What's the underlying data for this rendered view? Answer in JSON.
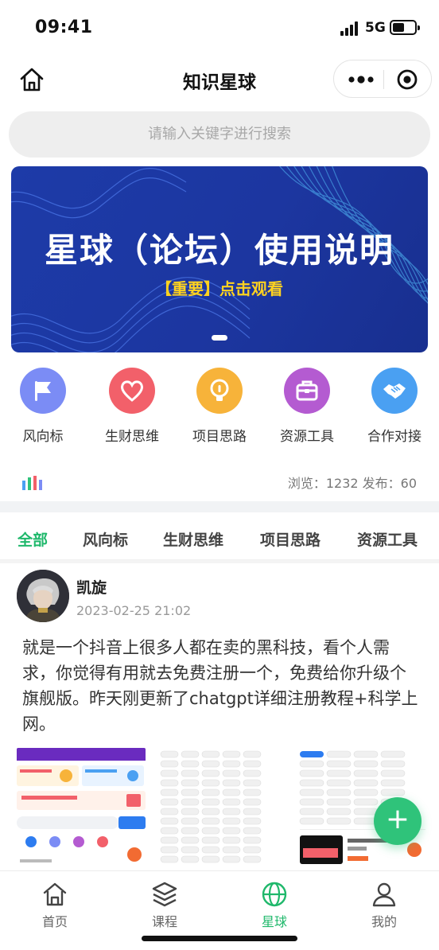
{
  "status_bar": {
    "time": "09:41",
    "network": "5G"
  },
  "nav": {
    "title": "知识星球"
  },
  "search": {
    "placeholder": "请输入关键字进行搜索"
  },
  "banner": {
    "title": "星球（论坛）使用说明",
    "subtitle": "【重要】点击观看"
  },
  "categories": [
    {
      "label": "风向标",
      "icon": "flag-icon",
      "color": "#7b8cf5"
    },
    {
      "label": "生财思维",
      "icon": "heart-icon",
      "color": "#f2606a"
    },
    {
      "label": "项目思路",
      "icon": "lightbulb-icon",
      "color": "#f7b33a"
    },
    {
      "label": "资源工具",
      "icon": "toolbox-icon",
      "color": "#b45bd1"
    },
    {
      "label": "合作对接",
      "icon": "handshake-icon",
      "color": "#4aa0f2"
    }
  ],
  "stats": {
    "text": "浏览：1232  发布：60"
  },
  "tabs": [
    {
      "label": "全部",
      "active": true
    },
    {
      "label": "风向标"
    },
    {
      "label": "生财思维"
    },
    {
      "label": "项目思路"
    },
    {
      "label": "资源工具"
    }
  ],
  "post": {
    "user": "凯旋",
    "time": "2023-02-25 21:02",
    "body": "就是一个抖音上很多人都在卖的黑科技，看个人需求，你觉得有用就去免费注册一个，免费给你升级个旗舰版。昨天刚更新了chatgpt详细注册教程+科学上网。"
  },
  "fab": {
    "label": "+"
  },
  "tab_bar": [
    {
      "label": "首页",
      "icon": "home-icon"
    },
    {
      "label": "课程",
      "icon": "layers-icon"
    },
    {
      "label": "星球",
      "icon": "globe-icon",
      "active": true
    },
    {
      "label": "我的",
      "icon": "user-icon"
    }
  ],
  "colors": {
    "accent": "#1fb86b",
    "banner": "#1d3ba8",
    "banner_sub": "#ffd21f"
  }
}
